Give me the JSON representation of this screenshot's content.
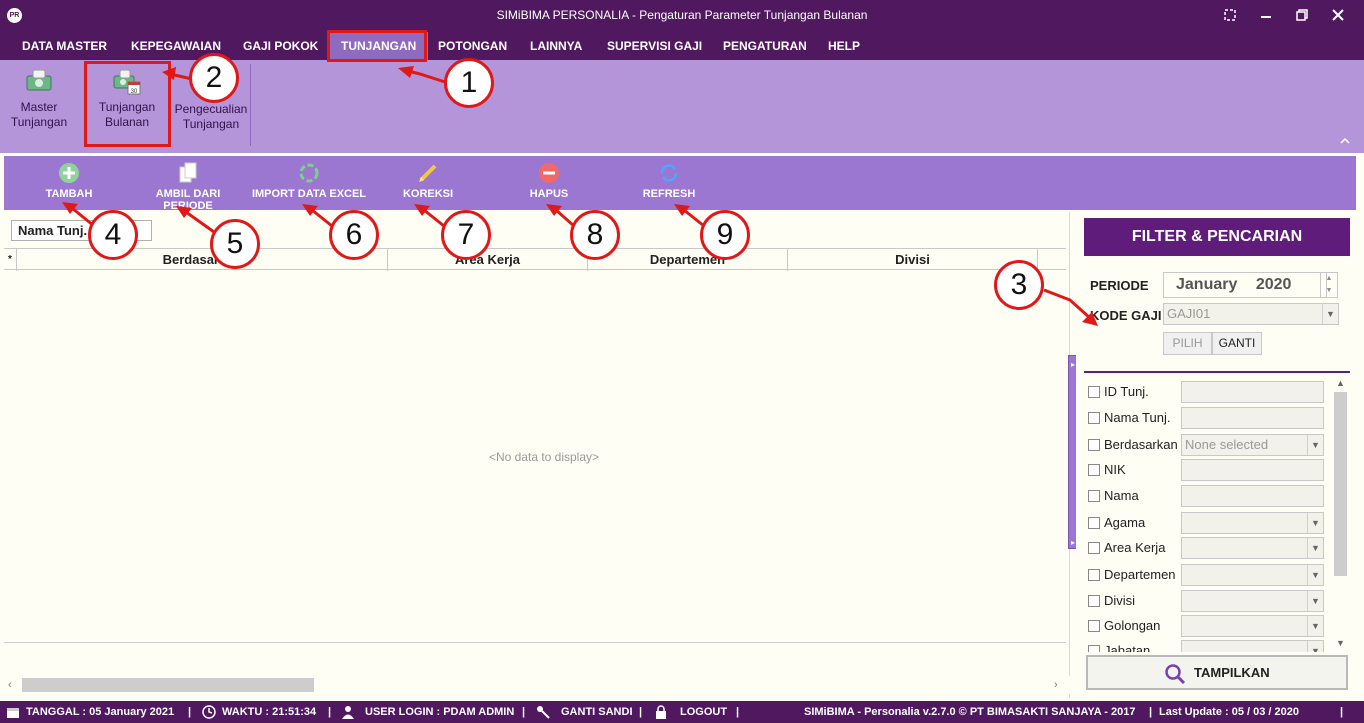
{
  "window": {
    "logo_text": "PR",
    "title": "SIMiBIMA PERSONALIA - Pengaturan Parameter Tunjangan Bulanan"
  },
  "menu": [
    {
      "label": "DATA MASTER"
    },
    {
      "label": "KEPEGAWAIAN"
    },
    {
      "label": "GAJI POKOK"
    },
    {
      "label": "TUNJANGAN",
      "active": true
    },
    {
      "label": "POTONGAN"
    },
    {
      "label": "LAINNYA"
    },
    {
      "label": "SUPERVISI GAJI"
    },
    {
      "label": "PENGATURAN"
    },
    {
      "label": "HELP"
    }
  ],
  "ribbon": [
    {
      "line1": "Master",
      "line2": "Tunjangan",
      "icon": "money-icon"
    },
    {
      "line1": "Tunjangan",
      "line2": "Bulanan",
      "icon": "calendar-money-icon"
    },
    {
      "line1": "Pengecualian",
      "line2": "Tunjangan",
      "icon": ""
    }
  ],
  "toolbar": [
    {
      "label": "TAMBAH",
      "icon": "plus-icon"
    },
    {
      "label": "AMBIL DARI PERIODE",
      "icon": "copy-icon"
    },
    {
      "label": "IMPORT DATA EXCEL",
      "icon": "import-icon"
    },
    {
      "label": "KOREKSI",
      "icon": "pencil-icon"
    },
    {
      "label": "HAPUS",
      "icon": "minus-icon"
    },
    {
      "label": "REFRESH",
      "icon": "refresh-icon"
    }
  ],
  "grid": {
    "group_field": "Nama Tunj.",
    "header_marker": "*",
    "columns": [
      "Berdasarkan",
      "Area Kerja",
      "Departemen",
      "Divisi"
    ],
    "empty_text": "<No data to display>"
  },
  "filter": {
    "title": "FILTER & PENCARIAN",
    "periode_label": "PERIODE",
    "periode_month": "January",
    "periode_year": "2020",
    "kode_gaji_label": "KODE GAJI",
    "kode_gaji_value": "GAJI01",
    "pilih_label": "PILIH",
    "ganti_label": "GANTI",
    "criteria": [
      {
        "label": "ID Tunj.",
        "type": "text",
        "value": ""
      },
      {
        "label": "Nama Tunj.",
        "type": "text",
        "value": ""
      },
      {
        "label": "Berdasarkan",
        "type": "select",
        "value": "None selected"
      },
      {
        "label": "NIK",
        "type": "text",
        "value": ""
      },
      {
        "label": "Nama",
        "type": "text",
        "value": ""
      },
      {
        "label": "Agama",
        "type": "select",
        "value": ""
      },
      {
        "label": "Area Kerja",
        "type": "select",
        "value": ""
      },
      {
        "label": "Departemen",
        "type": "select",
        "value": ""
      },
      {
        "label": "Divisi",
        "type": "select",
        "value": ""
      },
      {
        "label": "Golongan",
        "type": "select",
        "value": ""
      },
      {
        "label": "Jabatan",
        "type": "select",
        "value": ""
      }
    ],
    "tampilkan_label": "TAMPILKAN"
  },
  "status": {
    "tanggal": "TANGGAL :  05 January 2021",
    "waktu": "WAKTU :   21:51:34",
    "user": "USER LOGIN :  PDAM ADMIN",
    "ganti_sandi": "GANTI SANDI",
    "logout": "LOGOUT",
    "copyright": "SIMiBIMA - Personalia v.2.7.0 © PT BIMASAKTI SANJAYA - 2017",
    "last_update": "Last Update : 05 / 03 / 2020",
    "sep": "|"
  },
  "annotations": [
    "1",
    "2",
    "3",
    "4",
    "5",
    "6",
    "7",
    "8",
    "9"
  ],
  "colors": {
    "title_bar": "#50185f",
    "ribbon": "#b595d9",
    "toolbar": "#9c77d1",
    "filter_header": "#5f1c7a",
    "highlight": "#e01818"
  }
}
